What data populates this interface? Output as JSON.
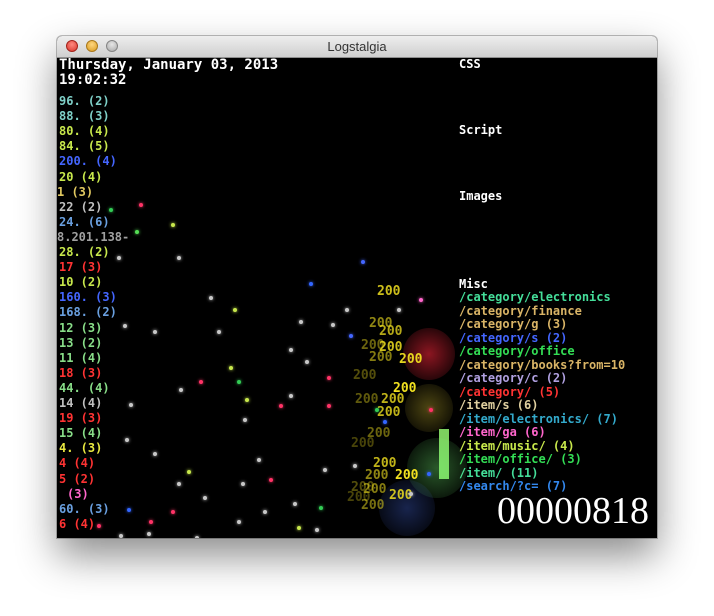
{
  "window": {
    "title": "Logstalgia"
  },
  "clock": {
    "date": "Thursday, January 03, 2013",
    "time": "19:02:32"
  },
  "hosts": [
    {
      "text": "96. (2)",
      "color": "#7fd0c8"
    },
    {
      "text": "88. (3)",
      "color": "#7fd0c8"
    },
    {
      "text": "80. (4)",
      "color": "#c8e84c"
    },
    {
      "text": "84. (5)",
      "color": "#c8e84c"
    },
    {
      "text": "200. (4)",
      "color": "#4466ff"
    },
    {
      "text": "20 (4)",
      "color": "#c8e84c"
    },
    {
      "text": "1 (3)",
      "color": "#e0c860"
    },
    {
      "text": "22 (2)",
      "color": "#c0c0c0"
    },
    {
      "text": "24. (6)",
      "color": "#6aa0e0"
    },
    {
      "text": "8.201.138-",
      "color": "#a0a0a0"
    },
    {
      "text": "28. (2)",
      "color": "#c8e84c"
    },
    {
      "text": "17 (3)",
      "color": "#ff3333"
    },
    {
      "text": "10 (2)",
      "color": "#c8e84c"
    },
    {
      "text": "160. (3)",
      "color": "#4466ff"
    },
    {
      "text": "168. (2)",
      "color": "#6aa0e0"
    },
    {
      "text": "12 (3)",
      "color": "#88dd88"
    },
    {
      "text": "13 (2)",
      "color": "#88dd88"
    },
    {
      "text": "11 (4)",
      "color": "#88dd88"
    },
    {
      "text": "18 (3)",
      "color": "#ff3333"
    },
    {
      "text": "44. (4)",
      "color": "#88dd88"
    },
    {
      "text": "14 (4)",
      "color": "#c0c0c0"
    },
    {
      "text": "19 (3)",
      "color": "#ff3333"
    },
    {
      "text": "15 (4)",
      "color": "#88dd88"
    },
    {
      "text": "4. (3)",
      "color": "#e8e840"
    },
    {
      "text": "4 (4)",
      "color": "#ff3333"
    },
    {
      "text": "5 (2)",
      "color": "#ff3333"
    },
    {
      "text": " (3)",
      "color": "#ff66cc"
    },
    {
      "text": "60. (3)",
      "color": "#6aa0e0"
    },
    {
      "text": "6 (4)",
      "color": "#ff3333"
    }
  ],
  "categories": {
    "css": "CSS",
    "script": "Script",
    "images": "Images",
    "misc": "Misc"
  },
  "paths": [
    {
      "text": "/category/electronics",
      "color": "#44dd99"
    },
    {
      "text": "/category/finance",
      "color": "#d9b466"
    },
    {
      "text": "/category/g (3)",
      "color": "#d9b466"
    },
    {
      "text": "/category/s (2)",
      "color": "#4466ff"
    },
    {
      "text": "/category/office",
      "color": "#33dd55"
    },
    {
      "text": "/category/books?from=10",
      "color": "#d9b466"
    },
    {
      "text": "/category/c (2)",
      "color": "#b0a0e0"
    },
    {
      "text": "/category/ (5)",
      "color": "#ff3333"
    },
    {
      "text": "/item/s (6)",
      "color": "#e0d0a0"
    },
    {
      "text": "/item/electronics/ (7)",
      "color": "#33aacc"
    },
    {
      "text": "/item/ga (6)",
      "color": "#ff66cc"
    },
    {
      "text": "/item/music/ (4)",
      "color": "#c8e84c"
    },
    {
      "text": "/item/office/ (3)",
      "color": "#33dd55"
    },
    {
      "text": "/item/ (11)",
      "color": "#44dd99"
    },
    {
      "text": "/search/?c= (7)",
      "color": "#3388ee"
    }
  ],
  "counter": "00000818",
  "responses": [
    "200",
    "200",
    "200",
    "200",
    "200",
    "200",
    "200",
    "200",
    "200",
    "200",
    "200",
    "200",
    "200",
    "200",
    "200",
    "200",
    "200",
    "200",
    "200",
    "200",
    "200",
    "200"
  ],
  "colors": {
    "bar": "#7cd05e",
    "response": "#f0e020"
  }
}
